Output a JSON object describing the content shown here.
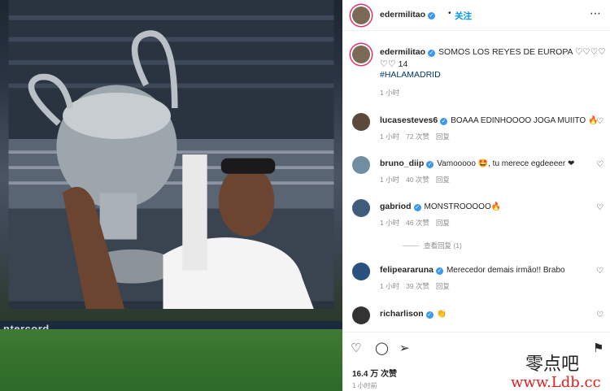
{
  "post": {
    "username": "edermilitao",
    "follow_label": "关注",
    "dot": "•",
    "more_icon": "more-icon"
  },
  "caption": {
    "username": "edermilitao",
    "text": "SOMOS LOS REYES DE EUROPA ♡♡♡♡",
    "hearts": "♡♡",
    "likes": "14",
    "hashtag": "#HALAMADRID",
    "time": "1 小时"
  },
  "comments": [
    {
      "user": "lucasesteves6",
      "text": "BOAAA EDINHOOOO JOGA MUIITO 🔥",
      "time": "1 小时",
      "likes": "72 次赞",
      "reply": "回复",
      "avatar_color": "#5b4a3c"
    },
    {
      "user": "bruno_diip",
      "text": "Vamooooo 🤩, tu merece egdeeeer ❤",
      "time": "1 小时",
      "likes": "40 次赞",
      "reply": "回复",
      "avatar_color": "#6f8fa0"
    },
    {
      "user": "gabriod",
      "text": "MONSTROOOOO🔥",
      "time": "1 小时",
      "likes": "46 次赞",
      "reply": "回复",
      "avatar_color": "#3d5d7a"
    },
    {
      "user": "felipeararuna",
      "text": "Merecedor demais irmão!! Brabo",
      "time": "1 小时",
      "likes": "39 次赞",
      "reply": "回复",
      "avatar_color": "#2a5080"
    },
    {
      "user": "richarlison",
      "text": "👏",
      "time": "",
      "likes": "",
      "reply": "",
      "avatar_color": "#333333"
    }
  ],
  "view_replies": "查看回复 (1)",
  "actions": {
    "likes_count": "16.4 万 次赞",
    "ago": "1 小时前"
  },
  "photo": {
    "board_text": "ntercord"
  },
  "watermark": {
    "line1": "零点吧",
    "line2": "www.Ldb.cc"
  },
  "colors": {
    "link": "#0095f6",
    "verified": "#3897f0",
    "hashtag": "#00376b",
    "story_ring": "#e1306c"
  }
}
